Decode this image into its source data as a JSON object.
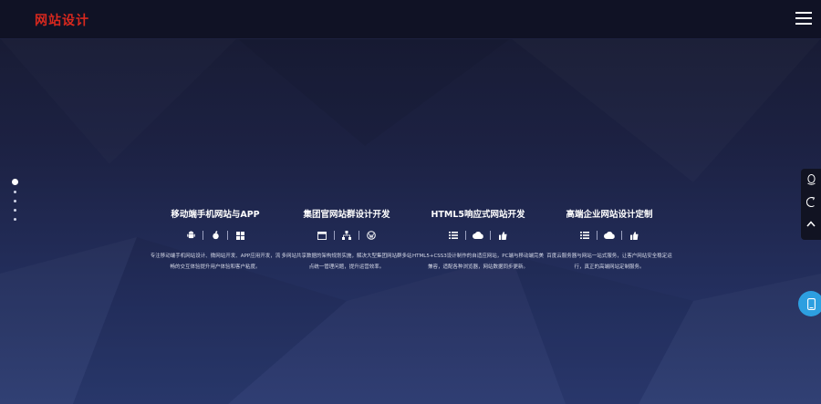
{
  "header": {
    "logo_text": "网站设计",
    "menu_icon": "hamburger-menu-icon",
    "logo_color": "#d8281e"
  },
  "slide_nav": {
    "count": 5,
    "active_index": 0
  },
  "services": [
    {
      "title": "移动端手机网站与APP",
      "icons": [
        "android-icon",
        "apple-icon",
        "windows-icon"
      ],
      "description": "专注移动端手机网站设计、微网站开发、APP应用开发，流畅的交互体验提升用户体验和客户粘度。"
    },
    {
      "title": "集团官网站群设计开发",
      "icons": [
        "window-icon",
        "network-icon",
        "wordpress-icon"
      ],
      "description": "多网站共享数据的架构规划实施，解决大型集团网站群多站点统一管理问题，提升运营效率。"
    },
    {
      "title": "HTML5响应式网站开发",
      "icons": [
        "list-icon",
        "cloud-icon",
        "thumbs-up-icon"
      ],
      "description": "HTML5+CSS3设计制作的自适应网站，PC端与移动端完美兼容，适配各种浏览器，网站数据同步更新。"
    },
    {
      "title": "高端企业网站设计定制",
      "icons": [
        "list-icon",
        "cloud-icon",
        "thumbs-up-icon"
      ],
      "description": "百度云服务器与网站一站式服务，让客户网站安全稳定运行，真正的高端网站定制服务。"
    }
  ],
  "side_tools": {
    "items": [
      "qq-icon",
      "phone-icon",
      "back-to-top-icon"
    ],
    "bubble_icon": "mobile-phone-icon",
    "bubble_color": "#2d9fe0"
  }
}
